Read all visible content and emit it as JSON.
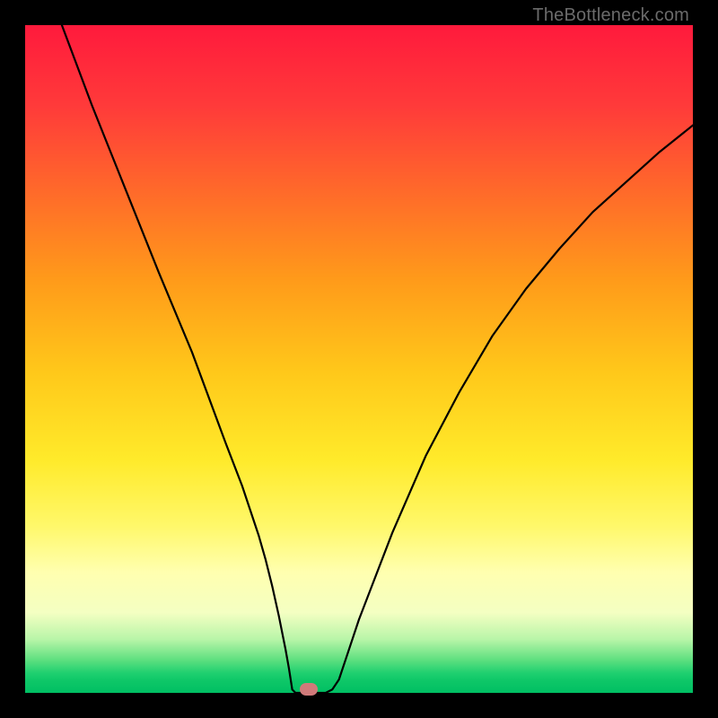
{
  "watermark": "TheBottleneck.com",
  "chart_data": {
    "type": "line",
    "title": "",
    "xlabel": "",
    "ylabel": "",
    "xlim": [
      0,
      1
    ],
    "ylim": [
      0,
      1
    ],
    "series": [
      {
        "name": "curve",
        "x": [
          0.055,
          0.1,
          0.15,
          0.2,
          0.25,
          0.3,
          0.325,
          0.35,
          0.36,
          0.37,
          0.38,
          0.39,
          0.395,
          0.398,
          0.4,
          0.405,
          0.45,
          0.46,
          0.47,
          0.48,
          0.5,
          0.55,
          0.6,
          0.65,
          0.7,
          0.75,
          0.8,
          0.85,
          0.9,
          0.95,
          1.0
        ],
        "y": [
          1.0,
          0.88,
          0.755,
          0.63,
          0.51,
          0.375,
          0.31,
          0.235,
          0.2,
          0.16,
          0.115,
          0.065,
          0.037,
          0.018,
          0.005,
          0.0,
          0.0,
          0.005,
          0.02,
          0.05,
          0.11,
          0.24,
          0.355,
          0.45,
          0.535,
          0.605,
          0.665,
          0.72,
          0.765,
          0.81,
          0.85
        ]
      }
    ],
    "marker": {
      "x": 0.425,
      "y": 0.005
    },
    "gradient_stops": [
      {
        "pos": 0.0,
        "color": "#ff1a3c"
      },
      {
        "pos": 0.5,
        "color": "#ffd21a"
      },
      {
        "pos": 0.85,
        "color": "#ffff9e"
      },
      {
        "pos": 1.0,
        "color": "#00bf63"
      }
    ]
  }
}
